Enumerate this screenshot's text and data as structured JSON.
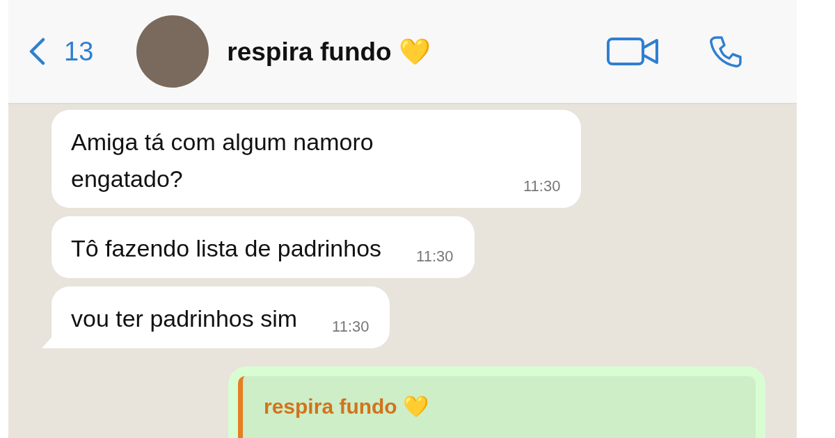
{
  "header": {
    "back_count": "13",
    "contact_name": "respira fundo 💛"
  },
  "messages": [
    {
      "kind": "incoming",
      "text": "Amiga tá com algum namoro engatado?",
      "time": "11:30",
      "tail": false
    },
    {
      "kind": "incoming",
      "text": "Tô fazendo lista de padrinhos",
      "time": "11:30",
      "tail": false
    },
    {
      "kind": "incoming",
      "text": "vou ter padrinhos sim",
      "time": "11:30",
      "tail": true
    },
    {
      "kind": "outgoing_reply",
      "quoted_author": "respira fundo 💛"
    }
  ]
}
